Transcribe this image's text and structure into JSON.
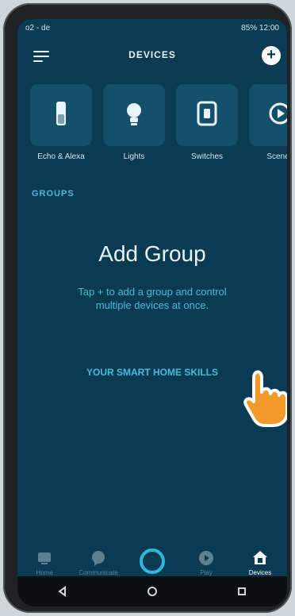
{
  "status": {
    "carrier": "o2 - de",
    "right": "85% 12:00"
  },
  "header": {
    "title": "DEVICES"
  },
  "categories": [
    {
      "label": "Echo & Alexa",
      "icon": "echo-icon"
    },
    {
      "label": "Lights",
      "icon": "bulb-icon"
    },
    {
      "label": "Switches",
      "icon": "switch-icon"
    },
    {
      "label": "Scenes",
      "icon": "scenes-icon"
    }
  ],
  "groups": {
    "heading": "GROUPS",
    "add_title": "Add Group",
    "description": "Tap + to add a group and control multiple devices at once."
  },
  "skills_link": "YOUR SMART HOME SKILLS",
  "bottom_nav": [
    {
      "label": "Home",
      "icon": "home-icon"
    },
    {
      "label": "Communicate",
      "icon": "chat-icon"
    },
    {
      "label": "",
      "icon": "alexa-icon"
    },
    {
      "label": "Play",
      "icon": "play-icon"
    },
    {
      "label": "Devices",
      "icon": "devices-icon",
      "active": true
    }
  ],
  "colors": {
    "background": "#0b3b52",
    "tile": "#14506b",
    "accent": "#4bb9da",
    "text": "#e9f3f7"
  }
}
